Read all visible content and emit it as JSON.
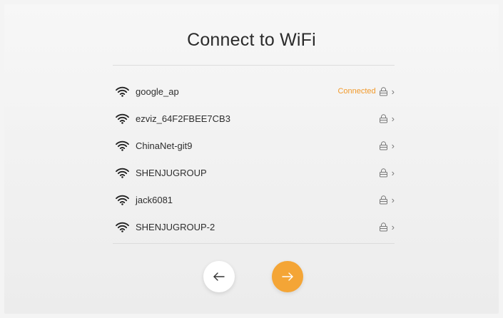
{
  "page": {
    "title": "Connect to WiFi"
  },
  "networks": [
    {
      "ssid": "google_ap",
      "status": "Connected"
    },
    {
      "ssid": "ezviz_64F2FBEE7CB3",
      "status": ""
    },
    {
      "ssid": "ChinaNet-git9",
      "status": ""
    },
    {
      "ssid": "SHENJUGROUP",
      "status": ""
    },
    {
      "ssid": "jack6081",
      "status": ""
    },
    {
      "ssid": "SHENJUGROUP-2",
      "status": ""
    }
  ],
  "icons": {
    "network": "wifi-icon",
    "secured": "lock-icon",
    "more": "chevron-right-icon",
    "back": "arrow-left-icon",
    "next": "arrow-right-icon"
  },
  "colors": {
    "accent": "#f4a536",
    "connected_text": "#f19a2c",
    "title_text": "#2b2b2b"
  }
}
